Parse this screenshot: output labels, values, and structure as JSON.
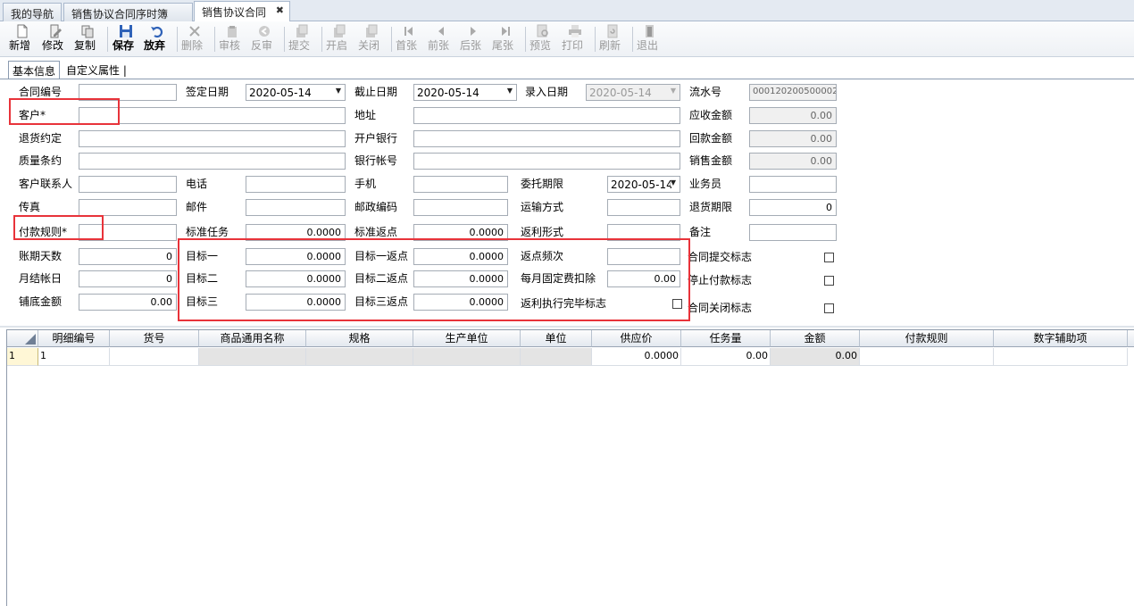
{
  "tabs": [
    "我的导航",
    "销售协议合同序时簿",
    "销售协议合同"
  ],
  "toolbar": [
    {
      "label": "新增",
      "icon": "new-doc-icon"
    },
    {
      "label": "修改",
      "icon": "edit-icon"
    },
    {
      "label": "复制",
      "icon": "copy-icon"
    },
    {
      "label": "保存",
      "icon": "save-icon"
    },
    {
      "label": "放弃",
      "icon": "undo-icon"
    },
    {
      "label": "删除",
      "icon": "delete-icon"
    },
    {
      "label": "审核",
      "icon": "audit-icon"
    },
    {
      "label": "反审",
      "icon": "unaudit-icon"
    },
    {
      "label": "提交",
      "icon": "submit-icon"
    },
    {
      "label": "开启",
      "icon": "open-icon"
    },
    {
      "label": "关闭",
      "icon": "close-doc-icon"
    },
    {
      "label": "首张",
      "icon": "first-icon"
    },
    {
      "label": "前张",
      "icon": "prev-icon"
    },
    {
      "label": "后张",
      "icon": "next-icon"
    },
    {
      "label": "尾张",
      "icon": "last-icon"
    },
    {
      "label": "预览",
      "icon": "preview-icon"
    },
    {
      "label": "打印",
      "icon": "print-icon"
    },
    {
      "label": "刷新",
      "icon": "refresh-icon"
    },
    {
      "label": "退出",
      "icon": "exit-icon"
    }
  ],
  "subtabs": [
    "基本信息",
    "自定义属性"
  ],
  "labels": {
    "contract_no": "合同编号",
    "sign_date": "签定日期",
    "end_date": "截止日期",
    "entry_date": "录入日期",
    "serial_no": "流水号",
    "customer": "客户*",
    "address": "地址",
    "receivable": "应收金额",
    "return_agreement": "退货约定",
    "bank": "开户银行",
    "payment_back": "回款金额",
    "quality": "质量条约",
    "bank_account": "银行帐号",
    "sales_amount": "销售金额",
    "contact": "客户联系人",
    "phone": "电话",
    "mobile": "手机",
    "commission": "委托期限",
    "salesman": "业务员",
    "fax": "传真",
    "email": "邮件",
    "postcode": "邮政编码",
    "transport": "运输方式",
    "return_period": "退货期限",
    "payment_rule": "付款规则*",
    "std_task": "标准任务",
    "std_rebate": "标准返点",
    "rebate_form": "返利形式",
    "remark": "备注",
    "credit_days": "账期天数",
    "target1": "目标一",
    "target1_rebate": "目标一返点",
    "rebate_freq": "返点频次",
    "submit_flag": "合同提交标志",
    "monthly_day": "月结帐日",
    "target2": "目标二",
    "target2_rebate": "目标二返点",
    "monthly_deduct": "每月固定费扣除",
    "stop_pay_flag": "停止付款标志",
    "base_amount": "铺底金额",
    "target3": "目标三",
    "target3_rebate": "目标三返点",
    "rebate_done_flag": "返利执行完毕标志",
    "close_flag": "合同关闭标志"
  },
  "values": {
    "sign_date": "2020-05-14",
    "end_date": "2020-05-14",
    "entry_date": "2020-05-14",
    "serial_no": "000120200500002",
    "receivable": "0.00",
    "payment_back": "0.00",
    "sales_amount": "0.00",
    "commission": "2020-05-14",
    "return_period": "0",
    "std_task": "0.0000",
    "std_rebate": "0.0000",
    "credit_days": "0",
    "target1": "0.0000",
    "target1_rebate": "0.0000",
    "monthly_day": "0",
    "target2": "0.0000",
    "target2_rebate": "0.0000",
    "monthly_deduct": "0.00",
    "base_amount": "0.00",
    "target3": "0.0000",
    "target3_rebate": "0.0000"
  },
  "grid": {
    "columns": [
      "明细编号",
      "货号",
      "商品通用名称",
      "规格",
      "生产单位",
      "单位",
      "供应价",
      "任务量",
      "金额",
      "付款规则",
      "数字辅助项"
    ],
    "row_index": "1",
    "row": [
      "1",
      "",
      "",
      "",
      "",
      "",
      "0.0000",
      "0.00",
      "0.00",
      "",
      ""
    ]
  }
}
